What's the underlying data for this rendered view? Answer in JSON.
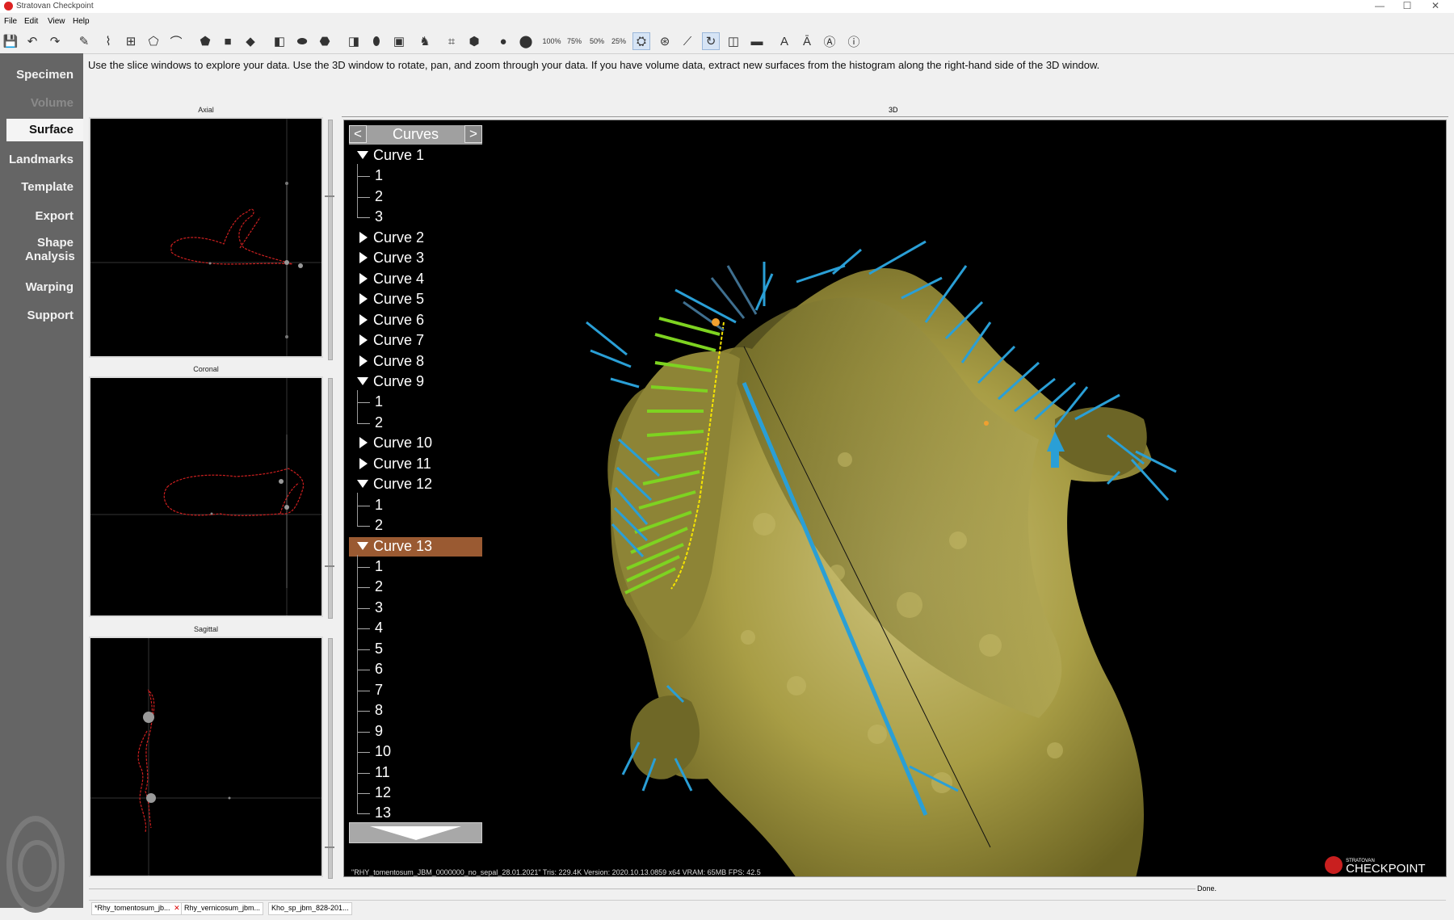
{
  "window": {
    "title": "Stratovan Checkpoint"
  },
  "menu": [
    "File",
    "Edit",
    "View",
    "Help"
  ],
  "toolbar": {
    "zoom_levels": [
      "100%",
      "75%",
      "50%",
      "25%"
    ]
  },
  "instruction": "Use the slice windows to explore your data. Use the 3D window to rotate, pan, and zoom through your data. If you have volume data, extract new surfaces from the histogram along the right-hand side of the 3D window.",
  "sidenav": {
    "items": [
      {
        "label": "Specimen",
        "state": "normal"
      },
      {
        "label": "Volume",
        "state": "disabled"
      },
      {
        "label": "Surface",
        "state": "active"
      },
      {
        "label": "Landmarks",
        "state": "normal"
      },
      {
        "label": "Template",
        "state": "normal"
      },
      {
        "label": "Export",
        "state": "normal"
      },
      {
        "label": "Shape Analysis",
        "state": "normal"
      },
      {
        "label": "Warping",
        "state": "normal"
      },
      {
        "label": "Support",
        "state": "normal"
      }
    ]
  },
  "slices": {
    "axial": "Axial",
    "coronal": "Coronal",
    "sagittal": "Sagittal"
  },
  "view3d": {
    "label": "3D",
    "curves_panel": {
      "title": "Curves",
      "prev": "<",
      "next": ">",
      "rows": [
        {
          "label": "Curve 1",
          "type": "parent",
          "expanded": true
        },
        {
          "label": "1",
          "type": "child"
        },
        {
          "label": "2",
          "type": "child"
        },
        {
          "label": "3",
          "type": "child"
        },
        {
          "label": "Curve 2",
          "type": "parent",
          "expanded": false
        },
        {
          "label": "Curve 3",
          "type": "parent",
          "expanded": false
        },
        {
          "label": "Curve 4",
          "type": "parent",
          "expanded": false
        },
        {
          "label": "Curve 5",
          "type": "parent",
          "expanded": false
        },
        {
          "label": "Curve 6",
          "type": "parent",
          "expanded": false
        },
        {
          "label": "Curve 7",
          "type": "parent",
          "expanded": false
        },
        {
          "label": "Curve 8",
          "type": "parent",
          "expanded": false
        },
        {
          "label": "Curve 9",
          "type": "parent",
          "expanded": true
        },
        {
          "label": "1",
          "type": "child"
        },
        {
          "label": "2",
          "type": "child"
        },
        {
          "label": "Curve 10",
          "type": "parent",
          "expanded": false
        },
        {
          "label": "Curve 11",
          "type": "parent",
          "expanded": false
        },
        {
          "label": "Curve 12",
          "type": "parent",
          "expanded": true
        },
        {
          "label": "1",
          "type": "child"
        },
        {
          "label": "2",
          "type": "child"
        },
        {
          "label": "Curve 13",
          "type": "parent",
          "expanded": true,
          "selected": true
        },
        {
          "label": "1",
          "type": "child"
        },
        {
          "label": "2",
          "type": "child"
        },
        {
          "label": "3",
          "type": "child"
        },
        {
          "label": "4",
          "type": "child"
        },
        {
          "label": "5",
          "type": "child"
        },
        {
          "label": "6",
          "type": "child"
        },
        {
          "label": "7",
          "type": "child"
        },
        {
          "label": "8",
          "type": "child"
        },
        {
          "label": "9",
          "type": "child"
        },
        {
          "label": "10",
          "type": "child"
        },
        {
          "label": "11",
          "type": "child"
        },
        {
          "label": "12",
          "type": "child"
        },
        {
          "label": "13",
          "type": "child"
        }
      ]
    },
    "status": "\"RHY_tomentosum_JBM_0000000_no_sepal_28.01.2021\" Tris: 229.4K Version: 2020.10.13.0859 x64 VRAM: 65MB FPS: 42.5",
    "brand_small": "STRATOVAN",
    "brand": "CHECKPOINT"
  },
  "statusbar": {
    "text": "Done."
  },
  "file_tabs": [
    "*Rhy_tomentosum_jb...",
    "Rhy_vernicosum_jbm...",
    "Kho_sp_jbm_828-201..."
  ],
  "colors": {
    "nav_bg": "#656565",
    "selected_row": "#9a5a32",
    "surface": "#a39a44",
    "arrow_blue": "#2a9fd6",
    "arrow_green": "#7ed321"
  }
}
